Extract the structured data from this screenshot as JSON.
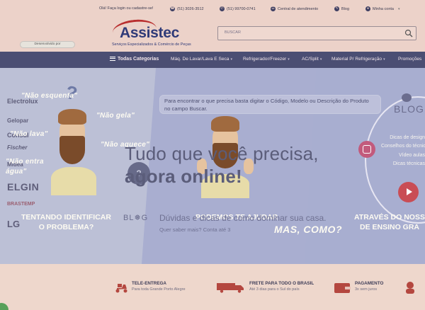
{
  "topbar": {
    "login": "Olá! Faça login ou cadastre-se!",
    "phone1": "(51) 3026-3512",
    "phone2": "(51) 99700-0741",
    "support": "Central de atendimento",
    "blog": "Blog",
    "account": "Minha conta"
  },
  "header": {
    "logo_name": "Assistec",
    "logo_tagline": "Serviços Especializados & Comércio de Peças",
    "search_placeholder": "BUSCAR"
  },
  "nav": {
    "all_categories": "Todas Categorias",
    "items": [
      "Máq. De Lavar/Lava E Seca",
      "Refrigerador/Freezer",
      "AC/Split",
      "Material P/ Refrigeração",
      "Promoções"
    ]
  },
  "banner": {
    "brands": [
      "Electrolux",
      "Gelopar",
      "Consul",
      "Fischer",
      "Midea",
      "ELGIN",
      "BRASTEMP",
      "LG"
    ],
    "slogans": [
      "\"Não esquenta\"",
      "\"Não gela\"",
      "\"Não lava\"",
      "\"Não aquece\"",
      "\"Não entra água\""
    ],
    "caption_left": [
      "TENTANDO IDENTIFICAR",
      "O PROBLEMA?"
    ],
    "caption_mid": "PODEMOS TE AJUDAR",
    "caption_right": [
      "ATRAVÉS DO NOSSO",
      "DE ENSINO GRA"
    ],
    "bubble_text": "Para encontrar o que precisa basta digitar o Código, Modelo ou Descrição do Produto no campo Buscar.",
    "headline1": "Tudo que você precisa,",
    "headline2": "agora online!",
    "blog_label": "BL❅G",
    "blog_big": "BLOG",
    "subline": "Dúvidas e dicas de como dominar sua casa.",
    "subline2": "Quer saber mais? Conta até 3",
    "handwritten": "MAS, COMO?",
    "blog_items": [
      "Dicas de design",
      "Conselhos do técnico",
      "Vídeo aulas",
      "Dicas técnicas"
    ]
  },
  "features": [
    {
      "title": "TELE-ENTREGA",
      "subtitle": "Para toda Grande Porto Alegre",
      "icon": "delivery-scooter-icon"
    },
    {
      "title": "FRETE PARA TODO O BRASIL",
      "subtitle": "Até 3 dias para o Sul do país",
      "icon": "truck-icon"
    },
    {
      "title": "PAGAMENTO",
      "subtitle": "3x sem juros",
      "icon": "wallet-icon"
    }
  ],
  "chip_text": "Desenvolvido por",
  "colors": {
    "nav_bg": "#4b4e73",
    "brand_red": "#b92f2f",
    "brand_navy": "#2f3a78",
    "banner_bg": "#b3b8d2"
  }
}
